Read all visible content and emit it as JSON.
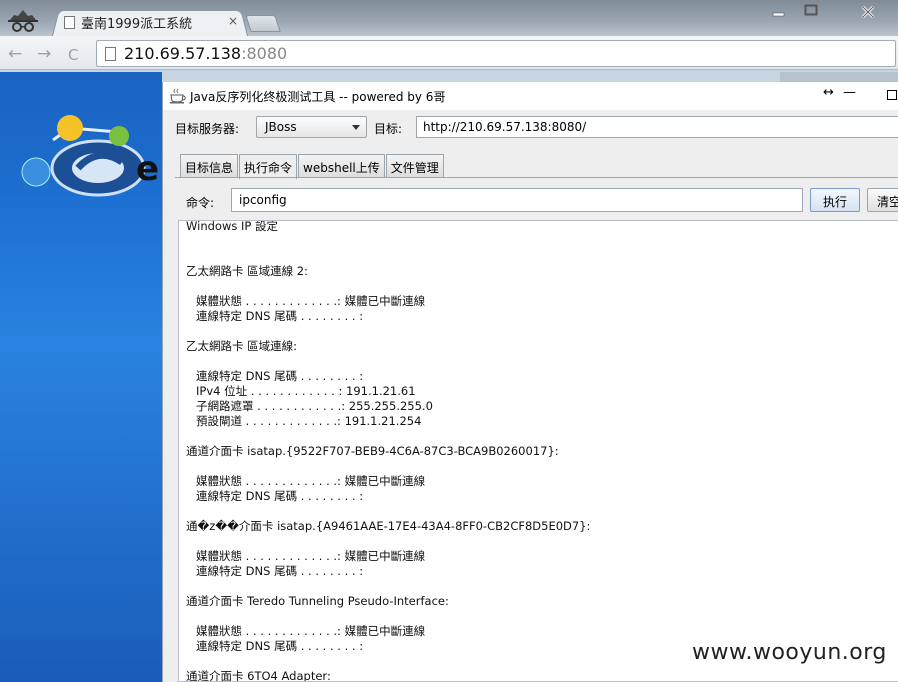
{
  "browser": {
    "tab_title": "臺南1999派工系統",
    "tab_close": "×",
    "url_host": "210.69.57.138",
    "url_port": ":8080",
    "back": "←",
    "forward": "→",
    "reload": "C"
  },
  "tool": {
    "title": "Java反序列化终极测试工具  -- powered by 6哥",
    "resize_glyph": "↔",
    "min_glyph": "—",
    "server_label": "目标服务器:",
    "server_value": "JBoss",
    "target_label": "目标:",
    "target_value": "http://210.69.57.138:8080/",
    "tabs": [
      "目标信息",
      "执行命令",
      "webshell上传",
      "文件管理"
    ],
    "active_tab": 1,
    "cmd_label": "命令:",
    "cmd_value": "ipconfig",
    "run_label": "执行",
    "clear_label": "清空"
  },
  "output": [
    {
      "text": "Windows IP 設定",
      "indent": 0
    },
    {
      "text": "",
      "indent": 0
    },
    {
      "text": "",
      "indent": 0
    },
    {
      "text": "乙太網路卡 區域連線 2:",
      "indent": 0
    },
    {
      "text": "",
      "indent": 0
    },
    {
      "text": "媒體狀態 . . . . . . . . . . . . .: 媒體已中斷連線",
      "indent": 1
    },
    {
      "text": "連線特定 DNS 尾碼 . . . . . . . . :",
      "indent": 1
    },
    {
      "text": "",
      "indent": 0
    },
    {
      "text": "乙太網路卡 區域連線:",
      "indent": 0
    },
    {
      "text": "",
      "indent": 0
    },
    {
      "text": "連線特定 DNS 尾碼 . . . . . . . . :",
      "indent": 1
    },
    {
      "text": "IPv4 位址 . . . . . . . . . . . . : 191.1.21.61",
      "indent": 1
    },
    {
      "text": "子網路遮罩 . . . . . . . . . . . .: 255.255.255.0",
      "indent": 1
    },
    {
      "text": "預設閘道 . . . . . . . . . . . . .: 191.1.21.254",
      "indent": 1
    },
    {
      "text": "",
      "indent": 0
    },
    {
      "text": "通道介面卡 isatap.{9522F707-BEB9-4C6A-87C3-BCA9B0260017}:",
      "indent": 0
    },
    {
      "text": "",
      "indent": 0
    },
    {
      "text": "媒體狀態 . . . . . . . . . . . . .: 媒體已中斷連線",
      "indent": 1
    },
    {
      "text": "連線特定 DNS 尾碼 . . . . . . . . :",
      "indent": 1
    },
    {
      "text": "",
      "indent": 0
    },
    {
      "text": "通�z��介面卡 isatap.{A9461AAE-17E4-43A4-8FF0-CB2CF8D5E0D7}:",
      "indent": 0
    },
    {
      "text": "",
      "indent": 0
    },
    {
      "text": "媒體狀態 . . . . . . . . . . . . .: 媒體已中斷連線",
      "indent": 1
    },
    {
      "text": "連線特定 DNS 尾碼 . . . . . . . . :",
      "indent": 1
    },
    {
      "text": "",
      "indent": 0
    },
    {
      "text": "通道介面卡 Teredo Tunneling Pseudo-Interface:",
      "indent": 0
    },
    {
      "text": "",
      "indent": 0
    },
    {
      "text": "媒體狀態 . . . . . . . . . . . . .: 媒體已中斷連線",
      "indent": 1
    },
    {
      "text": "連線特定 DNS 尾碼 . . . . . . . . :",
      "indent": 1
    },
    {
      "text": "",
      "indent": 0
    },
    {
      "text": "通道介面卡 6TO4 Adapter:",
      "indent": 0
    }
  ],
  "watermark": "www.wooyun.org",
  "colors": {
    "accent_blue": "#1c6fd0",
    "button_border": "#7a9ccc"
  }
}
